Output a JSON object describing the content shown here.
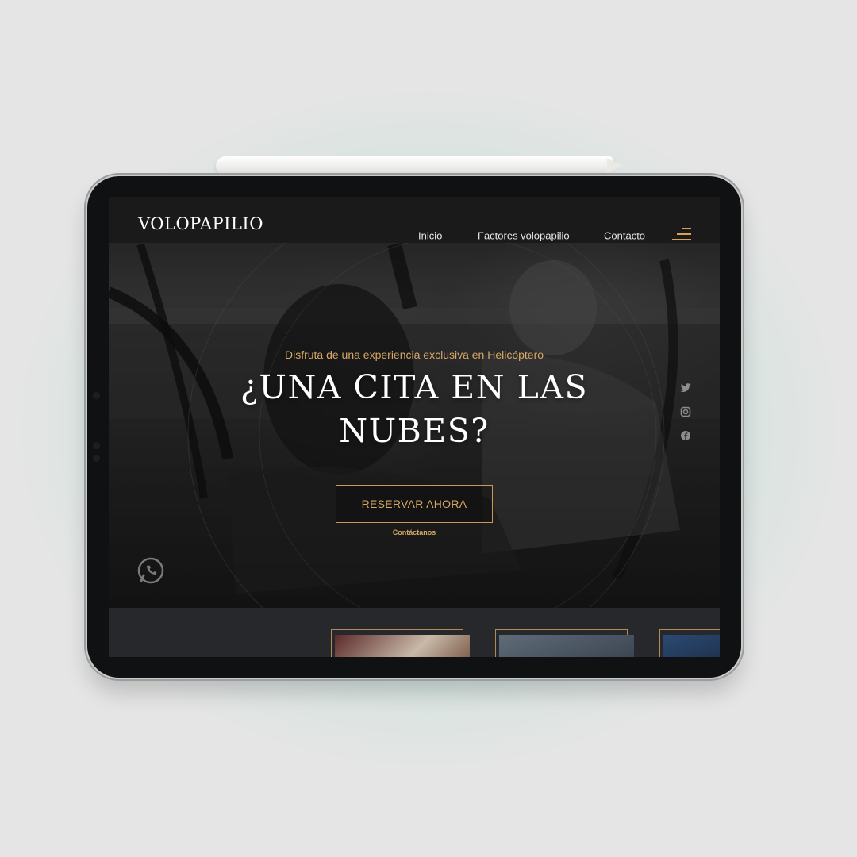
{
  "colors": {
    "accent": "#d6a766",
    "header_bg": "#1a1a1b",
    "text": "#ffffff"
  },
  "site": {
    "logo": "VOLOPAPILIO"
  },
  "nav": {
    "items": [
      {
        "label": "Inicio"
      },
      {
        "label": "Factores volopapilio"
      },
      {
        "label": "Contacto"
      }
    ],
    "menu_icon": "hamburger-icon"
  },
  "hero": {
    "subtitle": "Disfruta de una experiencia exclusiva en Helicóptero",
    "headline_line1": "¿UNA CITA EN LAS",
    "headline_line2": "NUBES?",
    "cta_label": "RESERVAR AHORA",
    "contact_link": "Contáctanos"
  },
  "social": {
    "icons": [
      "twitter-icon",
      "instagram-icon",
      "facebook-icon"
    ]
  },
  "floating": {
    "whatsapp_icon": "whatsapp-icon"
  }
}
